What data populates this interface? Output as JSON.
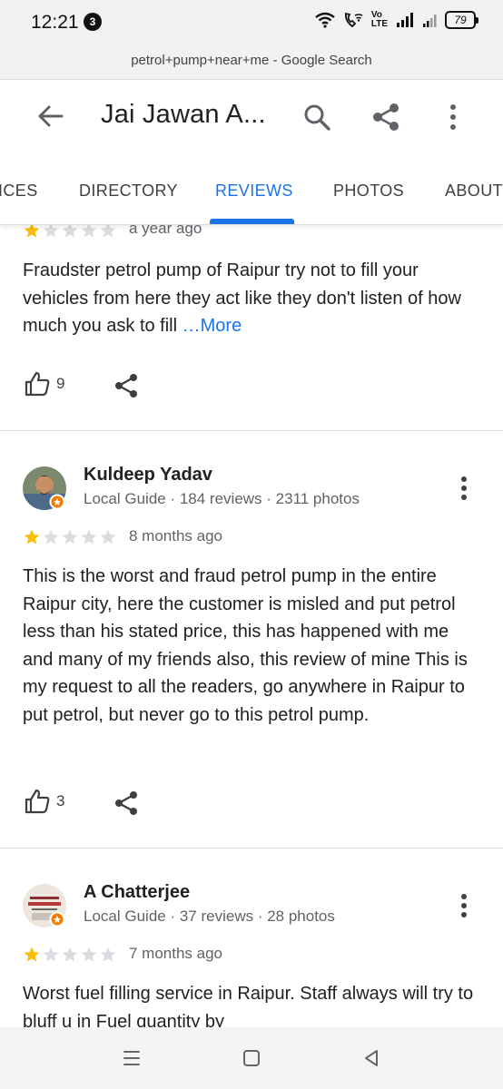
{
  "status_bar": {
    "time": "12:21",
    "notification_count": "3",
    "network": "Vo LTE",
    "battery": "79"
  },
  "browser": {
    "url_title": "petrol+pump+near+me - Google Search"
  },
  "header": {
    "title": "Jai Jawan A..."
  },
  "tabs": [
    {
      "label": "ICES"
    },
    {
      "label": "DIRECTORY"
    },
    {
      "label": "REVIEWS"
    },
    {
      "label": "PHOTOS"
    },
    {
      "label": "ABOUT"
    }
  ],
  "active_tab": "REVIEWS",
  "reviews": [
    {
      "rating": 1,
      "date": "a year ago",
      "text": "Fraudster petrol pump of Raipur try not to fill your vehicles from here they act like they don't listen of how much you ask to fill ",
      "more": "…More",
      "likes": "9"
    },
    {
      "name": "Kuldeep Yadav",
      "meta": "Local Guide · 184 reviews · 2311 photos",
      "rating": 1,
      "date": "8 months ago",
      "text": "This is the worst and fraud petrol pump in the entire Raipur city, here the customer is misled and put petrol less than his stated price, this has happened with me and many of my friends also, this review of mine This is my request to all the readers, go anywhere in Raipur to put petrol, but never go to this petrol pump.",
      "likes": "3"
    },
    {
      "name": "A Chatterjee",
      "meta": "Local Guide · 37 reviews · 28 photos",
      "rating": 1,
      "date": "7 months ago",
      "text": "Worst fuel filling service in Raipur. Staff always will try to bluff u in Fuel quantity by"
    }
  ],
  "colors": {
    "accent": "#1a73e8",
    "star_filled": "#fbbc04",
    "star_empty": "#dadce0",
    "local_guide_badge": "#f57c00"
  }
}
